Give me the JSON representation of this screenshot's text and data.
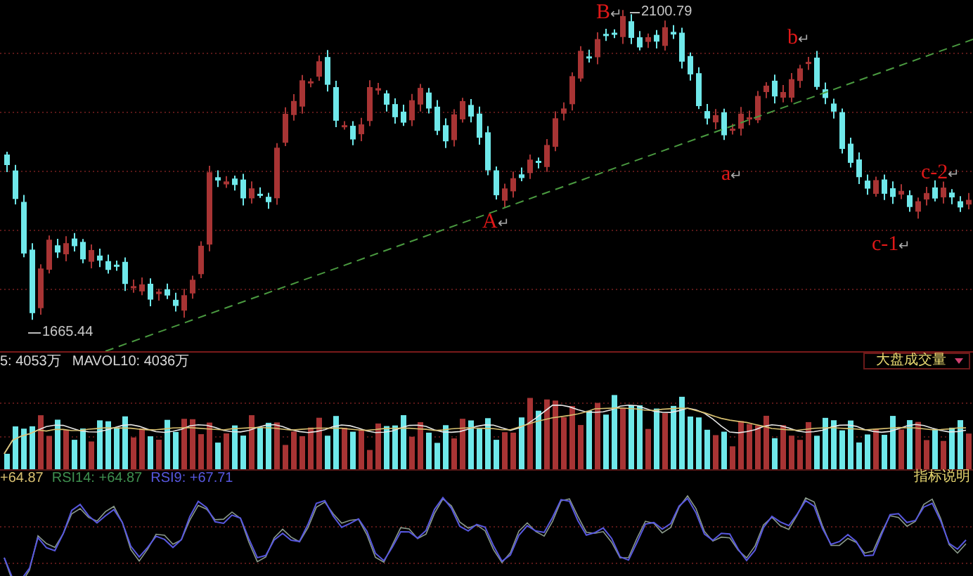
{
  "price_panel": {
    "high_label": "2100.79",
    "low_label": "1665.44",
    "annotations": [
      {
        "label": "B",
        "mark": "↵"
      },
      {
        "label": "b",
        "mark": "↵"
      },
      {
        "label": "a",
        "mark": "↵"
      },
      {
        "label": "c-2",
        "mark": "↵"
      },
      {
        "label": "A",
        "mark": "↵"
      },
      {
        "label": "c-1",
        "mark": "↵"
      }
    ]
  },
  "volume_panel": {
    "legend": [
      "5: 4053万",
      "MAVOL10: 4036万"
    ],
    "indicator_select": "大盘成交量"
  },
  "rsi_panel": {
    "legend": [
      {
        "text": "+64.87",
        "color": "#d8c070"
      },
      {
        "text": "RSI14: +64.87",
        "color": "#3f8f4f"
      },
      {
        "text": "RSI9: +67.71",
        "color": "#5858e0"
      }
    ],
    "help_link": "指标说明"
  }
}
